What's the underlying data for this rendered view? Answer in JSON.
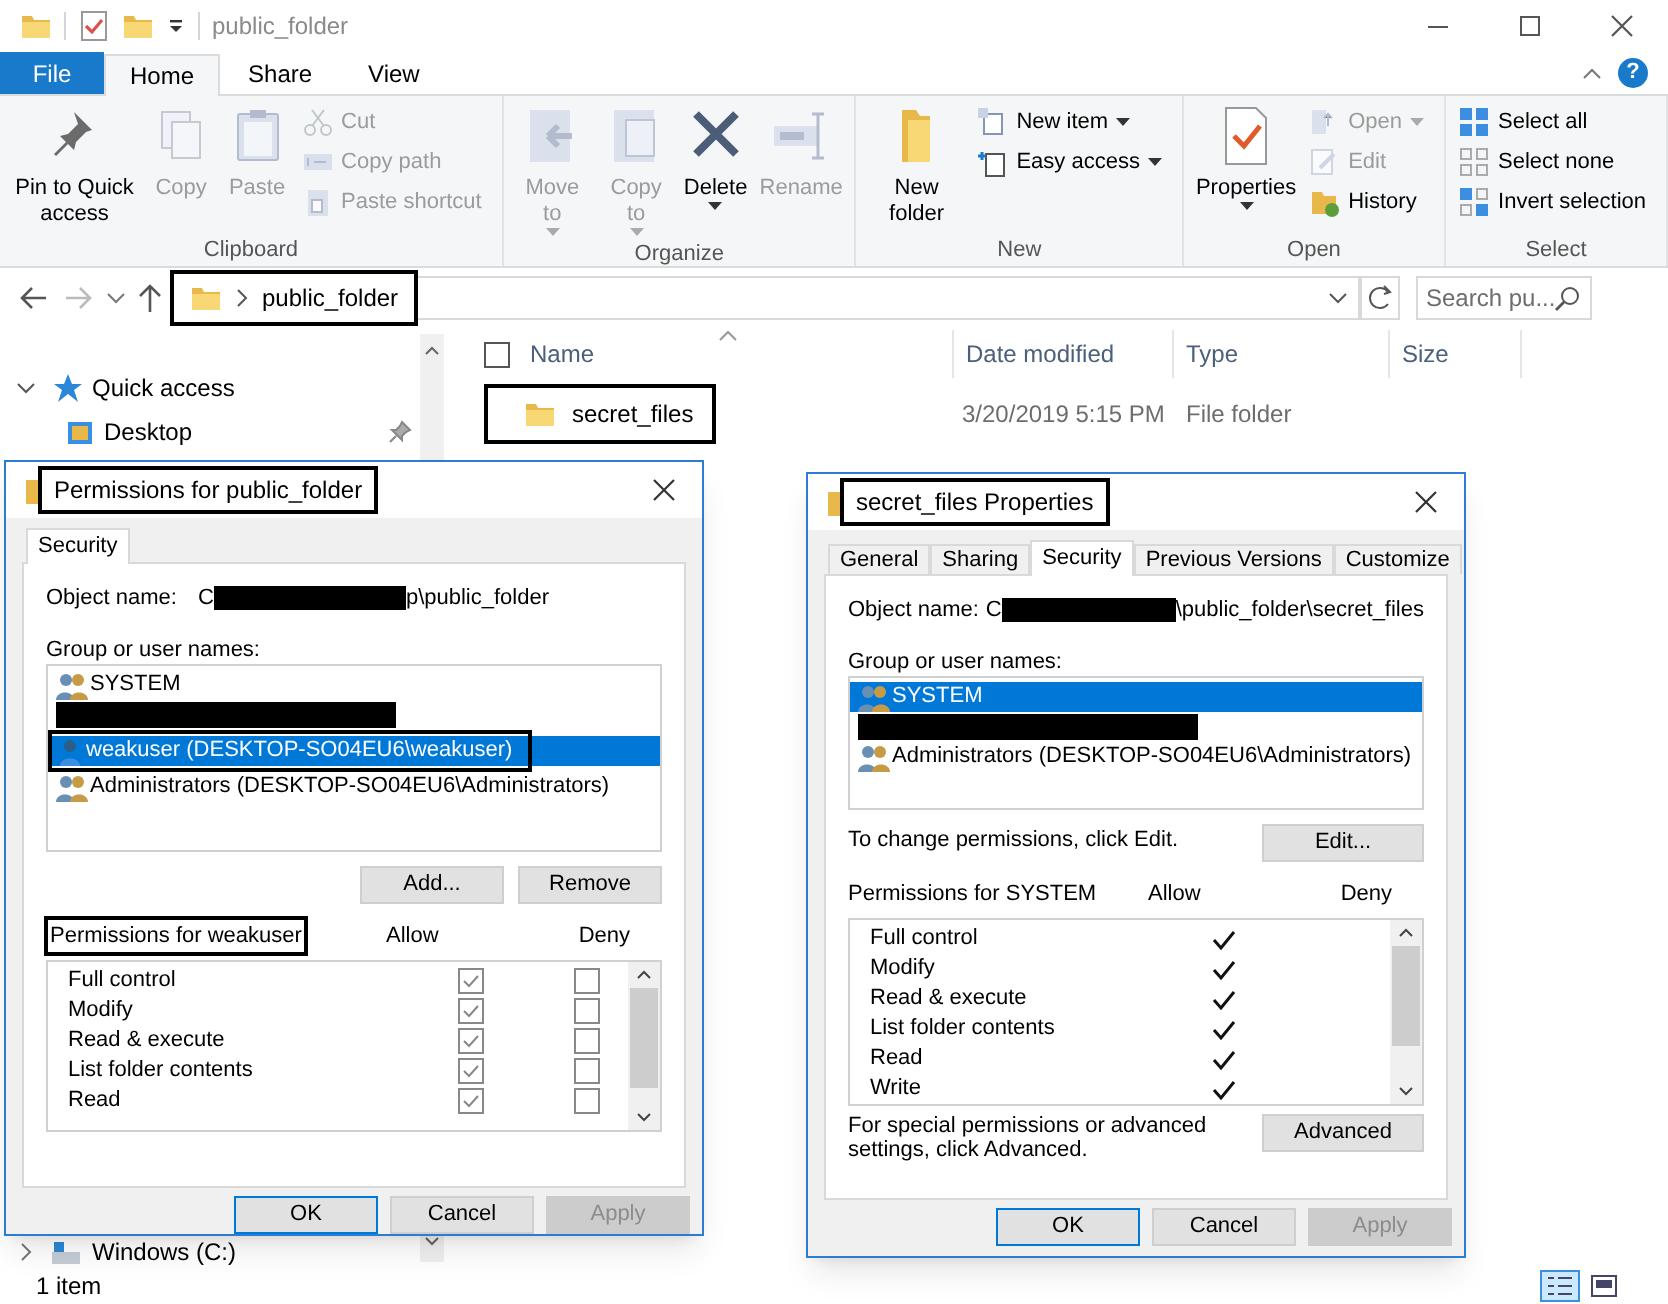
{
  "explorer": {
    "title": "public_folder",
    "ribbon_tabs": [
      {
        "label": "File",
        "kind": "file",
        "selected": false
      },
      {
        "label": "Home",
        "kind": "tab",
        "selected": true
      },
      {
        "label": "Share",
        "kind": "tab",
        "selected": false
      },
      {
        "label": "View",
        "kind": "tab",
        "selected": false
      }
    ],
    "help_glyph": "?",
    "ribbon_groups": [
      {
        "label": "Clipboard",
        "items": [
          {
            "label": "Pin to Quick access",
            "kind": "large",
            "disabled": false,
            "dropdown": false
          },
          {
            "label": "Copy",
            "kind": "large",
            "disabled": true,
            "dropdown": false
          },
          {
            "label": "Paste",
            "kind": "large",
            "disabled": true,
            "dropdown": false
          },
          {
            "label": "Cut",
            "kind": "small",
            "disabled": true,
            "dropdown": false
          },
          {
            "label": "Copy path",
            "kind": "small",
            "disabled": true,
            "dropdown": false
          },
          {
            "label": "Paste shortcut",
            "kind": "small",
            "disabled": true,
            "dropdown": false
          }
        ]
      },
      {
        "label": "Organize",
        "items": [
          {
            "label": "Move to",
            "kind": "large",
            "disabled": true,
            "dropdown": true
          },
          {
            "label": "Copy to",
            "kind": "large",
            "disabled": true,
            "dropdown": true
          },
          {
            "label": "Delete",
            "kind": "large",
            "disabled": false,
            "dropdown": true
          },
          {
            "label": "Rename",
            "kind": "large",
            "disabled": true,
            "dropdown": false
          }
        ]
      },
      {
        "label": "New",
        "items": [
          {
            "label": "New folder",
            "kind": "large",
            "disabled": false,
            "dropdown": false
          },
          {
            "label": "New item",
            "kind": "small",
            "disabled": false,
            "dropdown": true
          },
          {
            "label": "Easy access",
            "kind": "small",
            "disabled": false,
            "dropdown": true
          }
        ]
      },
      {
        "label": "Open",
        "items": [
          {
            "label": "Properties",
            "kind": "large",
            "disabled": false,
            "dropdown": true
          },
          {
            "label": "Open",
            "kind": "small",
            "disabled": true,
            "dropdown": true
          },
          {
            "label": "Edit",
            "kind": "small",
            "disabled": true,
            "dropdown": false
          },
          {
            "label": "History",
            "kind": "small",
            "disabled": false,
            "dropdown": false
          }
        ]
      },
      {
        "label": "Select",
        "items": [
          {
            "label": "Select all",
            "kind": "small",
            "disabled": false,
            "dropdown": false
          },
          {
            "label": "Select none",
            "kind": "small",
            "disabled": false,
            "dropdown": false
          },
          {
            "label": "Invert selection",
            "kind": "small",
            "disabled": false,
            "dropdown": false
          }
        ]
      }
    ],
    "address": {
      "path": "public_folder",
      "annotated": true
    },
    "search": {
      "placeholder": "Search pu..."
    },
    "nav_pane": [
      {
        "label": "Quick access",
        "kind": "section",
        "expanded": true
      },
      {
        "label": "Desktop",
        "kind": "item",
        "pinned": true
      }
    ],
    "nav_pane_bottom": [
      {
        "label": "Windows (C:)",
        "kind": "drive",
        "expanded": false
      }
    ],
    "columns": [
      {
        "label": "Name",
        "sorted": true
      },
      {
        "label": "Date modified",
        "sorted": false
      },
      {
        "label": "Type",
        "sorted": false
      },
      {
        "label": "Size",
        "sorted": false
      }
    ],
    "rows": [
      {
        "name": "secret_files",
        "date": "3/20/2019 5:15 PM",
        "type": "File folder",
        "annotated": true
      }
    ],
    "status": "1 item",
    "view_modes": [
      {
        "selected": true
      },
      {
        "selected": false
      }
    ]
  },
  "permissions_dialog": {
    "title": {
      "text": "Permissions for public_folder",
      "annotated": true
    },
    "tabs": [
      {
        "label": "Security",
        "selected": true
      }
    ],
    "object_name": {
      "label": "Object name:",
      "prefix": "C",
      "suffix": "p\\public_folder"
    },
    "group_label": "Group or user names:",
    "principals": [
      {
        "kind": "group",
        "name": "SYSTEM",
        "selected": false,
        "annotated": false
      },
      {
        "kind": "redacted",
        "selected": false
      },
      {
        "kind": "user",
        "name": "weakuser (DESKTOP-SO04EU6\\weakuser)",
        "selected": true,
        "annotated": true
      },
      {
        "kind": "group",
        "name": "Administrators (DESKTOP-SO04EU6\\Administrators)",
        "selected": false,
        "annotated": false
      }
    ],
    "list_buttons": [
      {
        "label": "Add..."
      },
      {
        "label": "Remove"
      }
    ],
    "permissions_header": {
      "text": "Permissions for weakuser",
      "annotated": true
    },
    "allow_label": "Allow",
    "deny_label": "Deny",
    "permissions": [
      {
        "kind": "checkbox",
        "name": "Full control",
        "allow": true,
        "deny": false
      },
      {
        "kind": "checkbox",
        "name": "Modify",
        "allow": true,
        "deny": false
      },
      {
        "kind": "checkbox",
        "name": "Read & execute",
        "allow": true,
        "deny": false
      },
      {
        "kind": "checkbox",
        "name": "List folder contents",
        "allow": true,
        "deny": false
      },
      {
        "kind": "checkbox",
        "name": "Read",
        "allow": true,
        "deny": false
      }
    ],
    "footer_buttons": [
      {
        "label": "OK",
        "default": true,
        "disabled": false
      },
      {
        "label": "Cancel",
        "default": false,
        "disabled": false
      },
      {
        "label": "Apply",
        "default": false,
        "disabled": true
      }
    ]
  },
  "properties_dialog": {
    "title": {
      "text": "secret_files Properties",
      "annotated": true
    },
    "tabs": [
      {
        "label": "General",
        "selected": false
      },
      {
        "label": "Sharing",
        "selected": false
      },
      {
        "label": "Security",
        "selected": true
      },
      {
        "label": "Previous Versions",
        "selected": false
      },
      {
        "label": "Customize",
        "selected": false
      }
    ],
    "object_name": {
      "label": "Object name:",
      "prefix": "C",
      "suffix": "\\public_folder\\secret_files"
    },
    "group_label": "Group or user names:",
    "principals": [
      {
        "kind": "group",
        "name": "SYSTEM",
        "selected": true,
        "annotated": false
      },
      {
        "kind": "redacted",
        "selected": false
      },
      {
        "kind": "group",
        "name": "Administrators (DESKTOP-SO04EU6\\Administrators)",
        "selected": false,
        "annotated": false
      }
    ],
    "edit_note": "To change permissions, click Edit.",
    "edit_button": "Edit...",
    "permissions_header": {
      "text": "Permissions for SYSTEM",
      "annotated": false
    },
    "allow_label": "Allow",
    "deny_label": "Deny",
    "permissions": [
      {
        "kind": "checkmark",
        "name": "Full control",
        "allow": true,
        "deny": false
      },
      {
        "kind": "checkmark",
        "name": "Modify",
        "allow": true,
        "deny": false
      },
      {
        "kind": "checkmark",
        "name": "Read & execute",
        "allow": true,
        "deny": false
      },
      {
        "kind": "checkmark",
        "name": "List folder contents",
        "allow": true,
        "deny": false
      },
      {
        "kind": "checkmark",
        "name": "Read",
        "allow": true,
        "deny": false
      },
      {
        "kind": "checkmark",
        "name": "Write",
        "allow": true,
        "deny": false
      }
    ],
    "advanced_note": "For special permissions or advanced settings, click Advanced.",
    "advanced_button": "Advanced",
    "footer_buttons": [
      {
        "label": "OK",
        "default": true,
        "disabled": false
      },
      {
        "label": "Cancel",
        "default": false,
        "disabled": false
      },
      {
        "label": "Apply",
        "default": false,
        "disabled": true
      }
    ]
  }
}
